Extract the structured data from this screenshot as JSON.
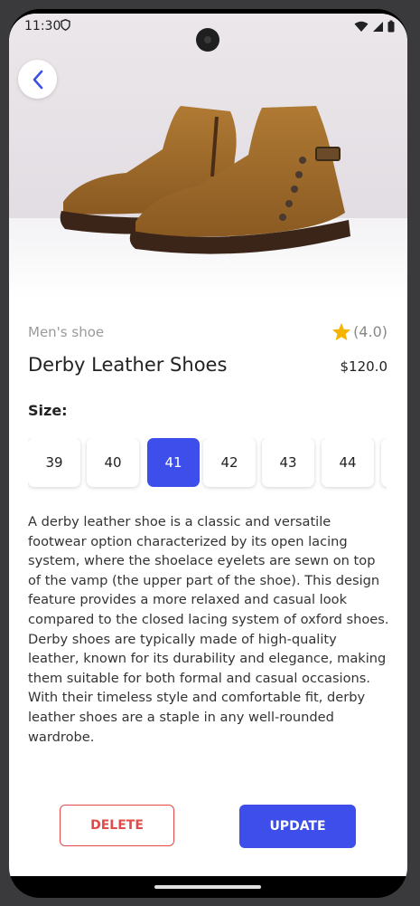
{
  "status_bar": {
    "time": "11:30"
  },
  "product": {
    "category": "Men's shoe",
    "rating": "(4.0)",
    "title": "Derby Leather Shoes",
    "price": "$120.0",
    "size_label": "Size:",
    "sizes": [
      "39",
      "40",
      "41",
      "42",
      "43",
      "44"
    ],
    "selected_size": "41",
    "description": "A derby leather shoe is a classic and versatile footwear option characterized by its open lacing system, where the shoelace eyelets are sewn on top of the vamp (the upper part of the shoe). This design feature provides a more relaxed and casual look compared to the closed lacing system of oxford shoes. Derby shoes are typically made of high-quality leather, known for its durability and elegance, making them suitable for both formal and casual occasions. With their timeless style and comfortable fit, derby leather shoes are a staple in any well-rounded wardrobe."
  },
  "actions": {
    "delete_label": "DELETE",
    "update_label": "UPDATE"
  },
  "colors": {
    "accent": "#3d4eea",
    "danger": "#e24a4a",
    "star": "#f4b400"
  },
  "icons": {
    "back": "arrow-left-icon",
    "star": "star-icon",
    "wifi": "wifi-icon",
    "signal": "signal-icon",
    "battery": "battery-icon",
    "shield": "shield-icon"
  }
}
